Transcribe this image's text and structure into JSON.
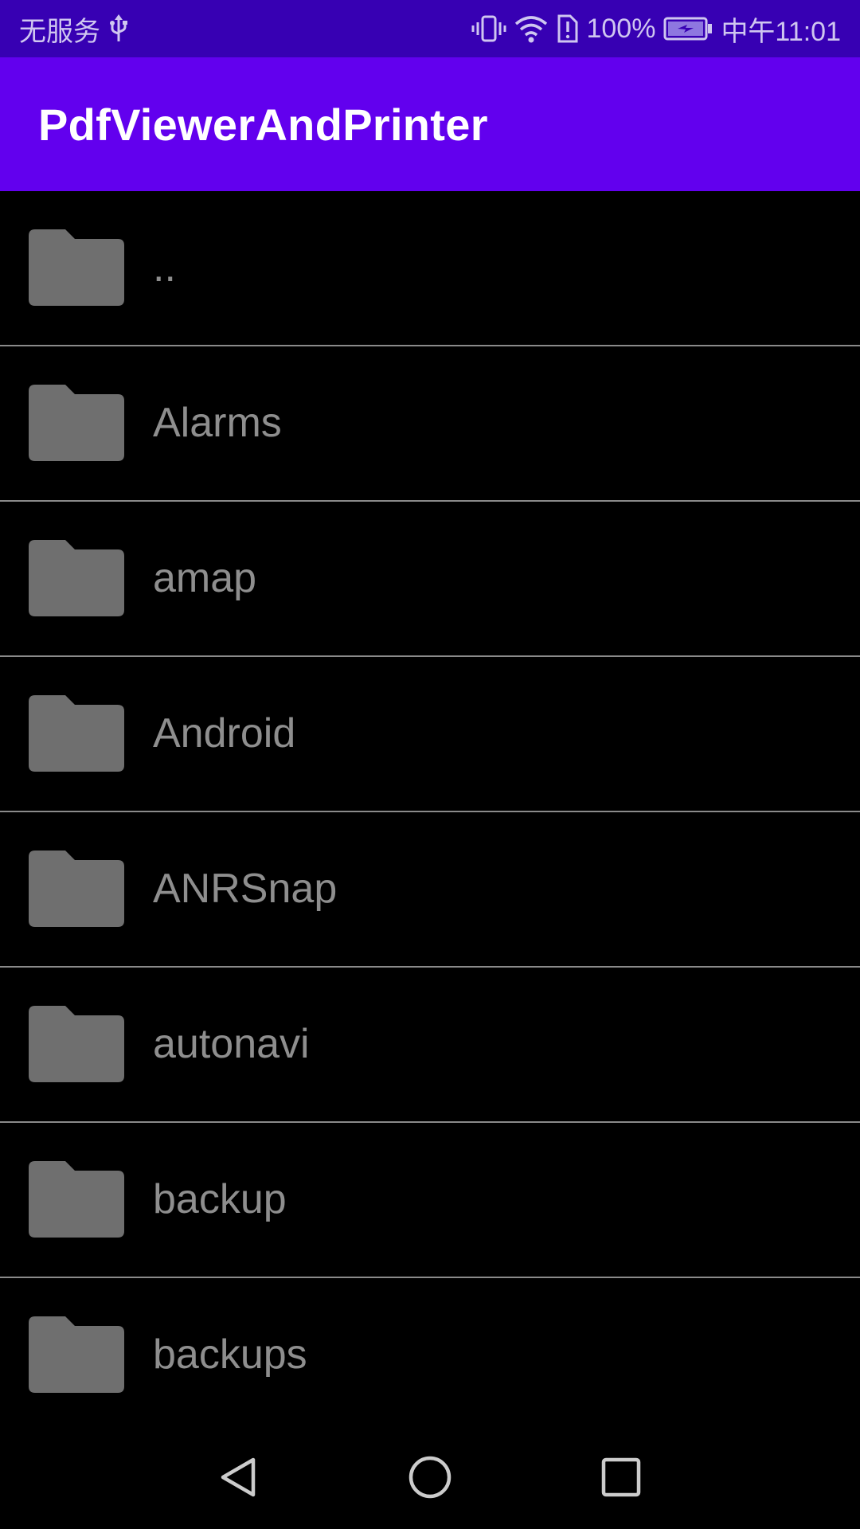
{
  "status_bar": {
    "carrier": "无服务",
    "battery_percent": "100%",
    "time": "中午11:01",
    "icons": [
      "usb-icon",
      "vibrate-icon",
      "wifi-icon",
      "sim-alert-icon",
      "battery-charging-icon"
    ]
  },
  "app_bar": {
    "title": "PdfViewerAndPrinter"
  },
  "file_list": {
    "items": [
      {
        "name": "..",
        "icon": "folder-icon"
      },
      {
        "name": "Alarms",
        "icon": "folder-icon"
      },
      {
        "name": "amap",
        "icon": "folder-icon"
      },
      {
        "name": "Android",
        "icon": "folder-icon"
      },
      {
        "name": "ANRSnap",
        "icon": "folder-icon"
      },
      {
        "name": "autonavi",
        "icon": "folder-icon"
      },
      {
        "name": "backup",
        "icon": "folder-icon"
      },
      {
        "name": "backups",
        "icon": "folder-icon"
      }
    ]
  },
  "nav_bar": {
    "buttons": [
      "back-icon",
      "home-icon",
      "recents-icon"
    ]
  },
  "colors": {
    "status_bar": "#3700b3",
    "app_bar": "#6200ee",
    "background": "#000000",
    "folder": "#6f6f6f",
    "item_text": "#8e8e8e",
    "divider": "#8a8a8a"
  }
}
